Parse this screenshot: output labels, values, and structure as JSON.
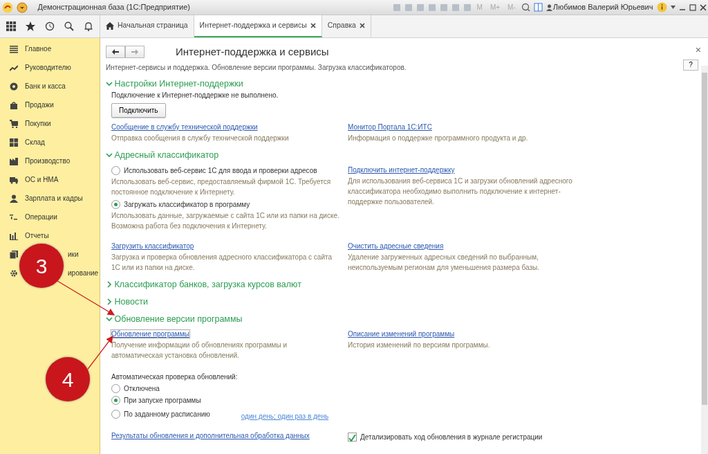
{
  "title_bar": {
    "title": "Демонстрационная база  (1С:Предприятие)",
    "memory_buttons": [
      "M",
      "M+",
      "M-"
    ],
    "user": "Любимов Валерий Юрьевич"
  },
  "tabs": [
    {
      "label": "Начальная страница",
      "selected": false,
      "closable": false
    },
    {
      "label": "Интернет-поддержка и сервисы",
      "selected": true,
      "closable": true
    },
    {
      "label": "Справка",
      "selected": false,
      "closable": true
    }
  ],
  "sidebar": {
    "items": [
      {
        "label": "Главное"
      },
      {
        "label": "Руководителю"
      },
      {
        "label": "Банк и касса"
      },
      {
        "label": "Продажи"
      },
      {
        "label": "Покупки"
      },
      {
        "label": "Склад"
      },
      {
        "label": "Производство"
      },
      {
        "label": "ОС и НМА"
      },
      {
        "label": "Зарплата и кадры"
      },
      {
        "label": "Операции"
      },
      {
        "label": "Отчеты"
      },
      {
        "label": "ики"
      },
      {
        "label": "ирование"
      }
    ]
  },
  "form": {
    "title": "Интернет-поддержка и сервисы",
    "description": "Интернет-сервисы и поддержка. Обновление версии программы. Загрузка классификаторов.",
    "help_button": "?",
    "close_button": "×",
    "sections": [
      {
        "title": "Настройки Интернет-поддержки",
        "expanded": true,
        "blocks": [
          {
            "kind": "text",
            "text": "Подключение к Интернет-поддержке не выполнено."
          },
          {
            "kind": "button",
            "label": "Подключить"
          },
          {
            "kind": "row",
            "left": [
              {
                "kind": "link",
                "text": "Сообщение в службу технической поддержки",
                "focused": false
              },
              {
                "kind": "hint",
                "text": "Отправка сообщения в службу технической поддержки"
              }
            ],
            "right": [
              {
                "kind": "link",
                "text": "Монитор Портала 1С:ИТС",
                "focused": false
              },
              {
                "kind": "hint",
                "text": "Информация о поддержке программного продукта и др."
              }
            ]
          }
        ]
      },
      {
        "title": "Адресный классификатор",
        "expanded": true,
        "blocks": [
          {
            "kind": "row",
            "left": [
              {
                "kind": "radio",
                "text": "Использовать веб-сервис 1С для ввода и проверки адресов",
                "selected": false
              },
              {
                "kind": "hint",
                "text": "Использовать веб-сервис, предоставляемый фирмой 1С. Требуется постоянное подключение к Интернету."
              },
              {
                "kind": "radio",
                "text": "Загружать классификатор в программу",
                "selected": true
              },
              {
                "kind": "hint",
                "text": "Использовать данные, загружаемые с сайта 1С или из папки на диске. Возможна работа без подключения к Интернету."
              }
            ],
            "right": [
              {
                "kind": "link",
                "text": "Подключить интернет-поддержку",
                "focused": false
              },
              {
                "kind": "hint",
                "text": "Для использования веб-сервиса 1С и загрузки обновлений адресного классификатора необходимо выполнить подключение к интернет-поддержке пользователей."
              }
            ]
          },
          {
            "kind": "row",
            "left": [
              {
                "kind": "link",
                "text": "Загрузить классификатор",
                "focused": false
              },
              {
                "kind": "hint",
                "text": "Загрузка и проверка обновления адресного классификатора с сайта 1С или из папки на диске."
              }
            ],
            "right": [
              {
                "kind": "link",
                "text": "Очистить адресные сведения",
                "focused": false
              },
              {
                "kind": "hint",
                "text": "Удаление загруженных адресных сведений по выбранным, неиспользуемым регионам для уменьшения размера базы."
              }
            ]
          }
        ]
      },
      {
        "title": "Классификатор банков, загрузка курсов валют",
        "expanded": false
      },
      {
        "title": "Новости",
        "expanded": false
      },
      {
        "title": "Обновление версии программы",
        "expanded": true,
        "blocks": [
          {
            "kind": "row",
            "left": [
              {
                "kind": "link",
                "text": "Обновление программы",
                "focused": true
              },
              {
                "kind": "hint",
                "text": "Получение информации об обновлениях программы и автоматическая установка обновлений."
              }
            ],
            "right": [
              {
                "kind": "link",
                "text": "Описание изменений программы",
                "focused": false
              },
              {
                "kind": "hint",
                "text": "История изменений по версиям программы."
              }
            ]
          },
          {
            "kind": "row",
            "left": [
              {
                "kind": "label",
                "text": "Автоматическая проверка обновлений:"
              },
              {
                "kind": "radio",
                "text": "Отключена",
                "selected": false
              },
              {
                "kind": "radio",
                "text": "При запуске программы",
                "selected": true
              },
              {
                "kind": "radio",
                "text": "По заданному расписанию",
                "selected": false,
                "schedule_link": "один день; один раз в день"
              }
            ]
          },
          {
            "kind": "row",
            "left": [
              {
                "kind": "link",
                "text": "Результаты обновления и дополнительная обработка данных",
                "focused": false
              }
            ],
            "right": [
              {
                "kind": "checkbox",
                "text": "Детализировать ход обновления в журнале регистрации",
                "checked": true
              }
            ]
          }
        ]
      }
    ]
  },
  "annotations": [
    {
      "label": "3"
    },
    {
      "label": "4"
    }
  ]
}
